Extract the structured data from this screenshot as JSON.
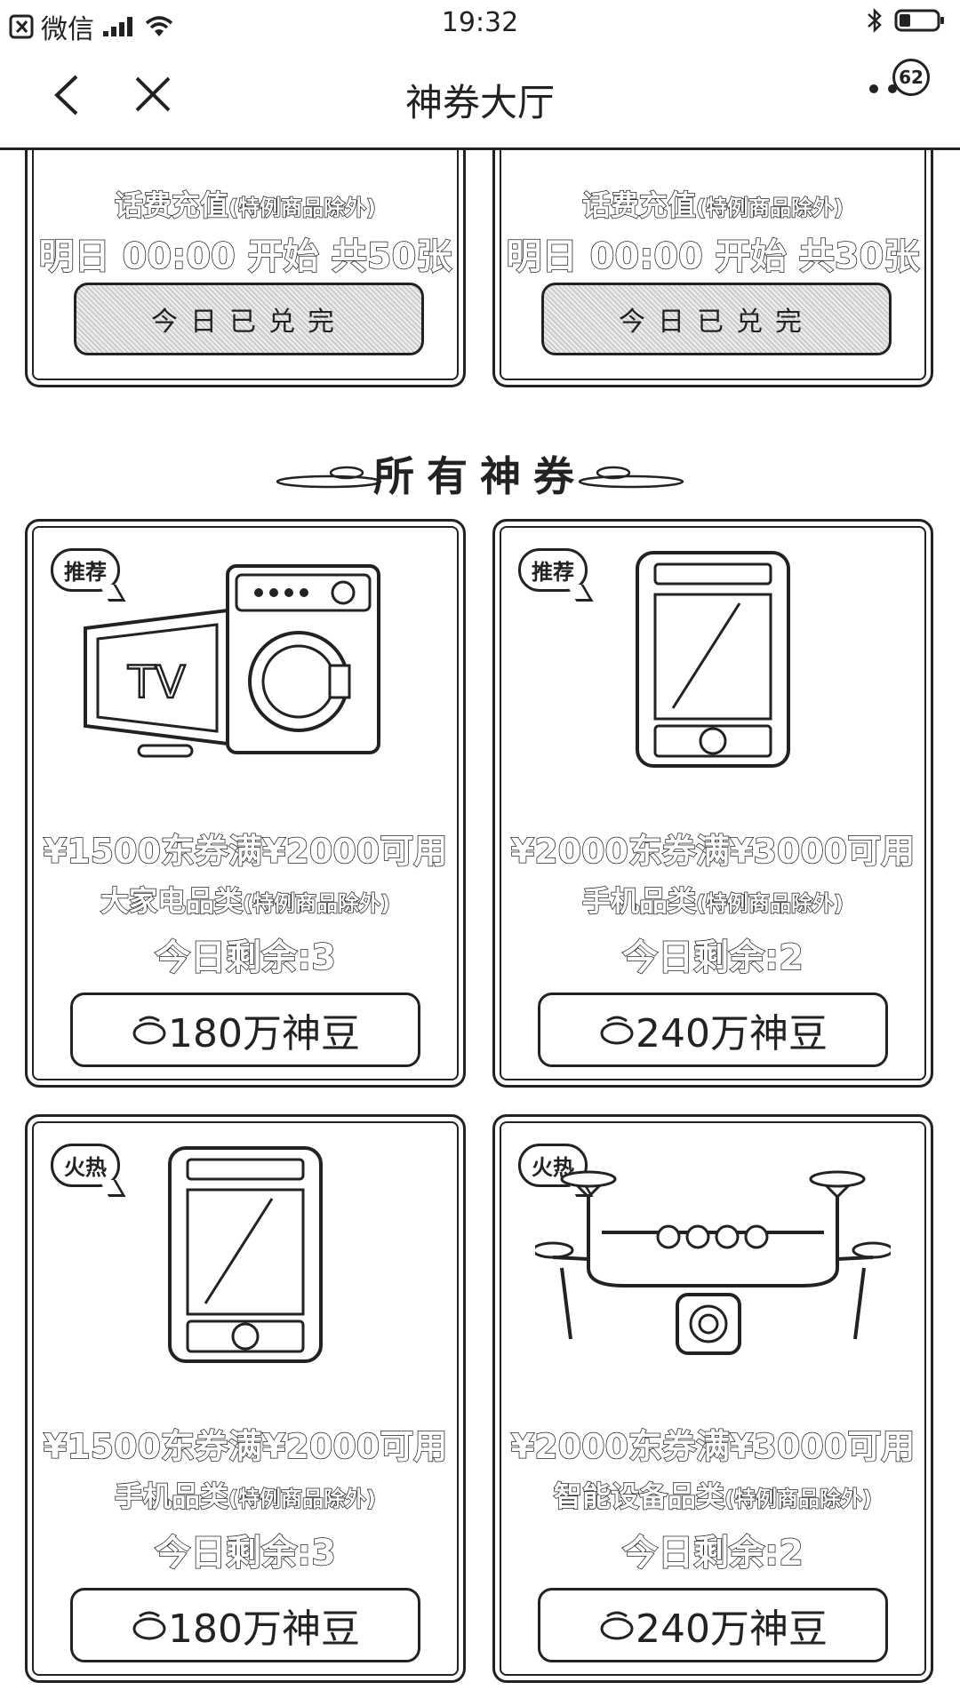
{
  "status_bar": {
    "app": "微信",
    "time": "19:32"
  },
  "nav": {
    "title": "神券大厅",
    "badge": "62"
  },
  "top_cards": [
    {
      "category": "话费充值",
      "note": "(特例商品除外)",
      "start_info": "明日 00:00 开始 共50张",
      "button": "今日已兑完"
    },
    {
      "category": "话费充值",
      "note": "(特例商品除外)",
      "start_info": "明日 00:00 开始 共30张",
      "button": "今日已兑完"
    }
  ],
  "section": {
    "title": "所有神券"
  },
  "cards": [
    {
      "tag": "推荐",
      "tv_label": "TV",
      "coupon": "¥1500东券满¥2000可用",
      "category": "大家电品类",
      "note": "(特例商品除外)",
      "remaining": "今日剩余:3",
      "price": "180万神豆"
    },
    {
      "tag": "推荐",
      "coupon": "¥2000东券满¥3000可用",
      "category": "手机品类",
      "note": "(特例商品除外)",
      "remaining": "今日剩余:2",
      "price": "240万神豆"
    },
    {
      "tag": "火热",
      "coupon": "¥1500东券满¥2000可用",
      "category": "手机品类",
      "note": "(特例商品除外)",
      "remaining": "今日剩余:3",
      "price": "180万神豆"
    },
    {
      "tag": "火热",
      "coupon": "¥2000东券满¥3000可用",
      "category": "智能设备品类",
      "note": "(特例商品除外)",
      "remaining": "今日剩余:2",
      "price": "240万神豆"
    }
  ]
}
